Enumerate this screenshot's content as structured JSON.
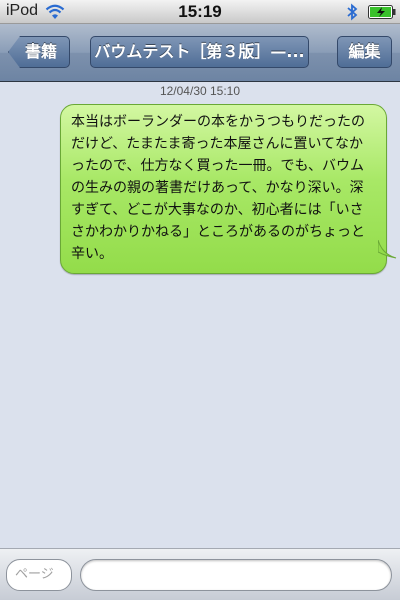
{
  "status_bar": {
    "carrier": "iPod",
    "time": "15:19"
  },
  "nav": {
    "back_label": "書籍",
    "title": "バウムテスト［第３版］—...",
    "edit_label": "編集"
  },
  "conversation": {
    "timestamp": "12/04/30 15:10",
    "messages": [
      {
        "text": "本当はボーランダーの本をかうつもりだったのだけど、たまたま寄った本屋さんに置いてなかったので、仕方なく買った一冊。でも、バウムの生みの親の著書だけあって、かなり深い。深すぎて、どこが大事なのか、初心者には「いささかわかりかねる」ところがあるのがちょっと辛い。"
      }
    ]
  },
  "input_bar": {
    "page_placeholder": "ページ",
    "message_value": ""
  },
  "colors": {
    "bubble_green": "#a8e866",
    "nav_blue": "#6d84a3",
    "background": "#dbe1ed"
  },
  "icons": [
    "wifi-icon",
    "bluetooth-icon",
    "battery-charging-icon",
    "back-arrow"
  ]
}
